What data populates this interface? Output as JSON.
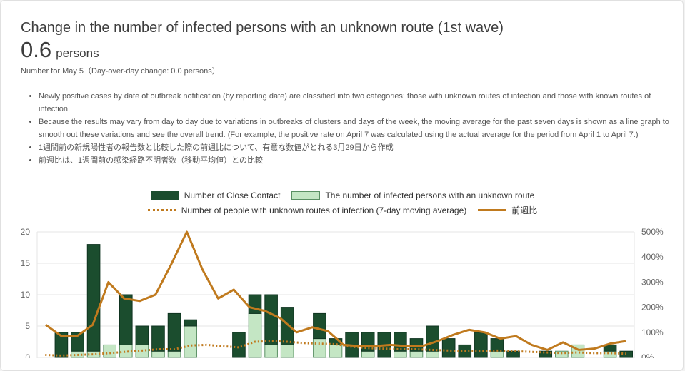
{
  "card": {
    "title": "Change in the number of infected persons with an unknown route (1st wave)",
    "value": "0.6",
    "unit": "persons",
    "date_note": "Number for May 5（Day-over-day change: 0.0 persons）",
    "notes": [
      "Newly positive cases by date of outbreak notification (by reporting date) are classified into two categories: those with unknown routes of infection and those with known routes of infection.",
      "Because the results may vary from day to day due to variations in outbreaks of clusters and days of the week, the moving average for the past seven days is shown as a line graph to smooth out these variations and see the overall trend. (For example, the positive rate on April 7 was calculated using the actual average for the period from April 1 to April 7.)",
      "1週間前の新規陽性者の報告数と比較した際の前週比について、有意な数値がとれる3月29日から作成",
      "前週比は、1週間前の感染経路不明者数（移動平均値）との比較"
    ]
  },
  "colors": {
    "close_contact": "#1b4d2e",
    "unknown_route": "#c4e6c4",
    "unknown_border": "#5a8f63",
    "moving_avg": "#c07a1e",
    "wow": "#c07a1e",
    "grid": "#e6e6e6"
  },
  "chart_data": {
    "type": "bar",
    "days": 37,
    "legend": {
      "close_contact": "Number of Close Contact",
      "unknown_route": "The number of infected persons with an unknown route",
      "moving_avg": "Number of people with unknown routes of infection (7-day moving average)",
      "wow": "前週比"
    },
    "y_left": {
      "range": [
        0,
        20
      ],
      "ticks": [
        "0",
        "5",
        "10",
        "15",
        "20"
      ],
      "tick_values": [
        0,
        5,
        10,
        15,
        20
      ]
    },
    "y_right": {
      "range": [
        0,
        500
      ],
      "ticks": [
        "0%",
        "100%",
        "200%",
        "300%",
        "400%",
        "500%"
      ],
      "tick_values": [
        0,
        100,
        200,
        300,
        400,
        500
      ]
    },
    "series": [
      {
        "name": "Number of Close Contact",
        "type": "bar",
        "stack": "cases",
        "values": [
          0,
          4,
          3,
          17,
          0,
          8,
          3,
          4,
          6,
          1,
          0,
          0,
          4,
          3,
          8,
          6,
          0,
          4,
          1,
          4,
          3,
          4,
          3,
          2,
          4,
          3,
          2,
          4,
          2,
          1,
          0,
          1,
          0,
          0,
          0,
          1,
          1
        ]
      },
      {
        "name": "The number of infected persons with an unknown route",
        "type": "bar",
        "stack": "cases",
        "values": [
          0,
          0,
          1,
          1,
          2,
          2,
          2,
          1,
          1,
          5,
          0,
          0,
          0,
          7,
          2,
          2,
          0,
          3,
          2,
          0,
          1,
          0,
          1,
          1,
          1,
          0,
          0,
          0,
          1,
          0,
          0,
          0,
          1,
          2,
          0,
          1,
          0
        ]
      },
      {
        "name": "Number of people with unknown routes of infection (7-day moving average)",
        "type": "line",
        "axis": "left",
        "values": [
          0.4,
          0.3,
          0.4,
          0.5,
          0.7,
          0.9,
          1.1,
          1.3,
          1.3,
          1.9,
          2.0,
          1.8,
          1.6,
          2.5,
          2.6,
          2.5,
          2.3,
          2.2,
          2.1,
          1.7,
          1.5,
          1.4,
          1.3,
          1.3,
          1.2,
          1.1,
          1.0,
          1.0,
          1.1,
          1.0,
          0.9,
          0.8,
          0.7,
          0.8,
          0.7,
          0.7,
          0.6
        ]
      },
      {
        "name": "前週比",
        "type": "line",
        "axis": "right",
        "values": [
          130,
          85,
          85,
          130,
          300,
          235,
          225,
          250,
          370,
          500,
          350,
          235,
          270,
          200,
          185,
          155,
          100,
          120,
          105,
          50,
          45,
          45,
          50,
          45,
          45,
          65,
          90,
          110,
          100,
          75,
          85,
          50,
          30,
          60,
          30,
          35,
          55,
          65
        ]
      }
    ]
  }
}
